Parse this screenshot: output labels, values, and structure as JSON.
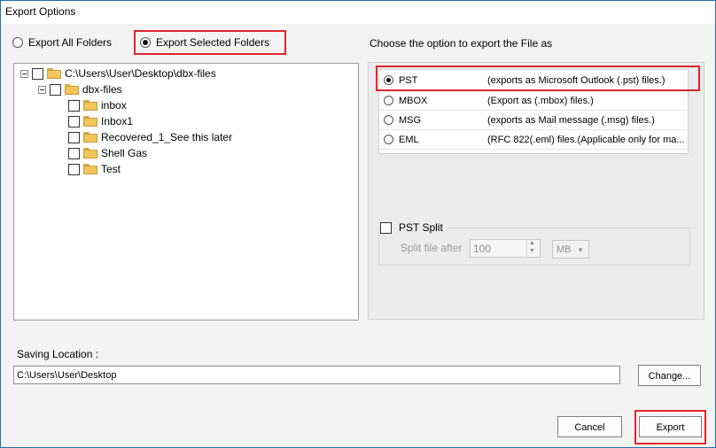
{
  "window": {
    "title": "Export Options"
  },
  "export_mode": {
    "all_label": "Export All Folders",
    "selected_label": "Export Selected Folders",
    "selected": "selected"
  },
  "tree": {
    "root": "C:\\Users\\User\\Desktop\\dbx-files",
    "child": "dbx-files",
    "items": [
      "inbox",
      "Inbox1",
      "Recovered_1_See this later",
      "Shell Gas",
      "Test"
    ]
  },
  "format": {
    "heading": "Choose the option to export the File as",
    "selected": "PST",
    "options": [
      {
        "name": "PST",
        "desc": "(exports as Microsoft Outlook (.pst) files.)"
      },
      {
        "name": "MBOX",
        "desc": "(Export as (.mbox) files.)"
      },
      {
        "name": "MSG",
        "desc": "(exports as Mail message (.msg) files.)"
      },
      {
        "name": "EML",
        "desc": "(RFC 822(.eml) files.(Applicable only for ma..."
      }
    ]
  },
  "split": {
    "label": "PST Split",
    "after_label": "Split file after",
    "value": "100",
    "unit": "MB"
  },
  "saving": {
    "label": "Saving Location :",
    "path": "C:\\Users\\User\\Desktop",
    "change_label": "Change..."
  },
  "buttons": {
    "cancel": "Cancel",
    "export": "Export"
  },
  "colors": {
    "highlight": "#e0262b",
    "window_border": "#1f6fb5"
  }
}
